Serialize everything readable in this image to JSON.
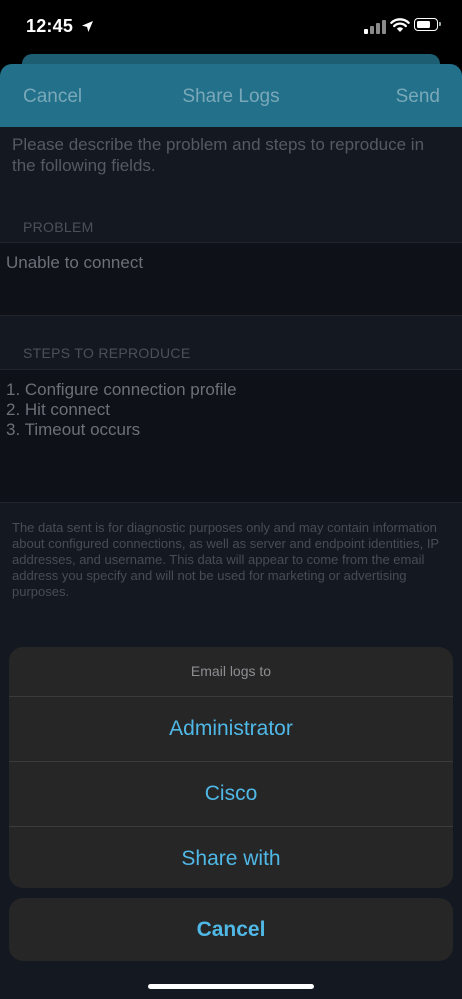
{
  "status_bar": {
    "time": "12:45"
  },
  "nav": {
    "cancel": "Cancel",
    "title": "Share Logs",
    "send": "Send"
  },
  "form": {
    "intro": "Please describe the problem and steps to reproduce in the following fields.",
    "problem_label": "PROBLEM",
    "problem_value": "Unable to connect",
    "steps_label": "STEPS TO REPRODUCE",
    "steps_value": "1. Configure connection profile\n2. Hit connect\n3. Timeout occurs",
    "disclaimer": "The data sent is for diagnostic purposes only and may contain information about configured connections, as well as server and endpoint identities, IP addresses, and username. This data will appear to come from the email address you specify and will not be used for marketing or advertising purposes."
  },
  "action_sheet": {
    "header": "Email logs to",
    "items": [
      {
        "label": "Administrator"
      },
      {
        "label": "Cisco"
      },
      {
        "label": "Share with"
      }
    ],
    "cancel": "Cancel"
  },
  "colors": {
    "accent": "#4fb8e6",
    "nav_bar": "#23708a",
    "sheet_bg": "#262626"
  }
}
